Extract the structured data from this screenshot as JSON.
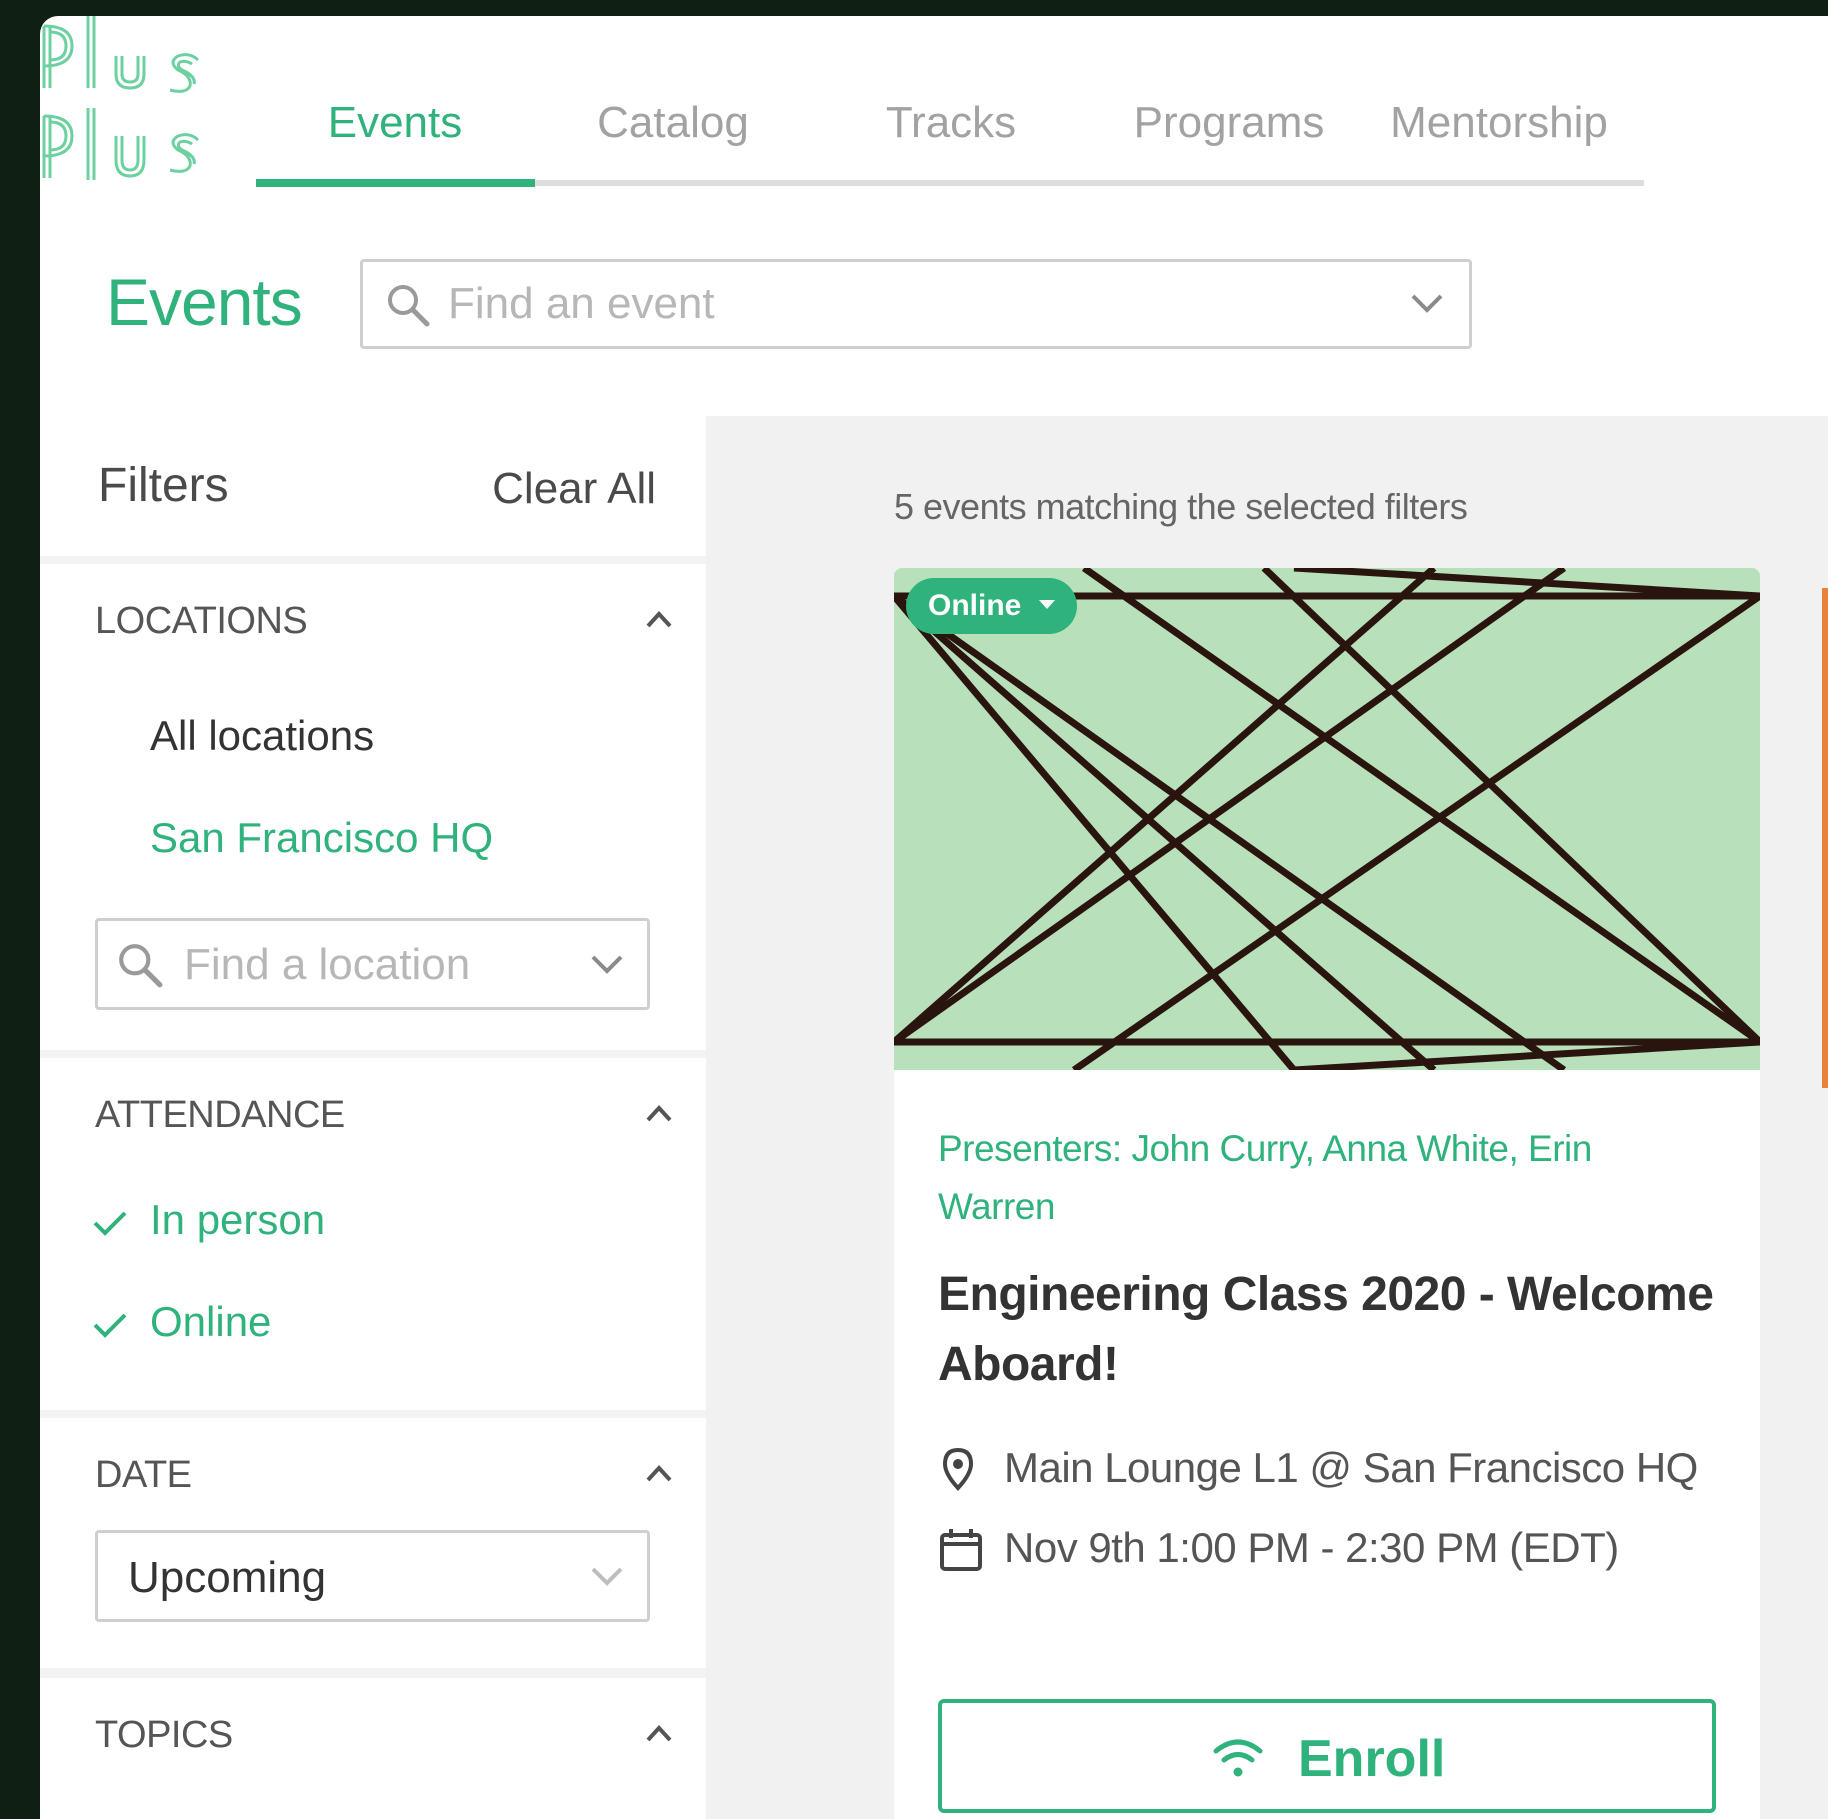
{
  "brand": {
    "logo_text": "Plus Plus",
    "accent_color": "#2fb27c"
  },
  "nav": {
    "tabs": [
      {
        "label": "Events",
        "active": true
      },
      {
        "label": "Catalog",
        "active": false
      },
      {
        "label": "Tracks",
        "active": false
      },
      {
        "label": "Programs",
        "active": false
      },
      {
        "label": "Mentorship",
        "active": false
      }
    ]
  },
  "header": {
    "title": "Events",
    "search_placeholder": "Find an event"
  },
  "filters": {
    "title": "Filters",
    "clear_all": "Clear All",
    "locations": {
      "title": "LOCATIONS",
      "options": [
        {
          "label": "All locations",
          "selected": false
        },
        {
          "label": "San Francisco HQ",
          "selected": true
        }
      ],
      "search_placeholder": "Find a location"
    },
    "attendance": {
      "title": "ATTENDANCE",
      "options": [
        {
          "label": "In person",
          "checked": true
        },
        {
          "label": "Online",
          "checked": true
        }
      ]
    },
    "date": {
      "title": "DATE",
      "selected": "Upcoming"
    },
    "topics": {
      "title": "TOPICS"
    }
  },
  "results": {
    "count_text": "5 events matching the selected filters",
    "events": [
      {
        "badge": "Online",
        "presenters": "Presenters: John Curry, Anna White, Erin Warren",
        "title": "Engineering Class 2020 - Welcome Aboard!",
        "location": "Main Lounge L1 @ San Francisco HQ",
        "datetime": "Nov 9th 1:00 PM - 2:30 PM (EDT)",
        "action": "Enroll",
        "image_bg": "#b8e0bb"
      }
    ]
  }
}
